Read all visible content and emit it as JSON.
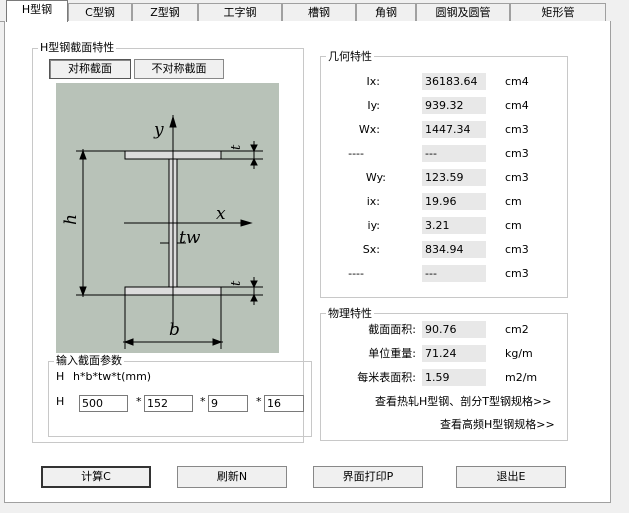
{
  "tabs": [
    "H型钢",
    "C型钢",
    "Z型钢",
    "工字钢",
    "槽钢",
    "角钢",
    "圆钢及圆管",
    "矩形管"
  ],
  "section": {
    "title": "H型钢截面特性",
    "sym_button": "对称截面",
    "asym_button": "不对称截面"
  },
  "diagram": {
    "y_label": "y",
    "x_label": "x",
    "tw_label": "tw",
    "h_label": "h",
    "b_label": "b",
    "t_top_label": "t",
    "t_bottom_label": "t"
  },
  "input": {
    "title": "输入截面参数",
    "prefix": "H",
    "formula": "h*b*tw*t(mm)",
    "row_label": "H",
    "h_value": "500",
    "b_value": "152",
    "tw_value": "9",
    "t_value": "16",
    "sep1": "*",
    "sep2": "*",
    "sep3": "*"
  },
  "geometry": {
    "title": "几何特性",
    "rows": [
      {
        "label": "Ix:",
        "value": "36183.64",
        "unit": "cm4"
      },
      {
        "label": "Iy:",
        "value": "939.32",
        "unit": "cm4"
      },
      {
        "label": "Wx:",
        "value": "1447.34",
        "unit": "cm3"
      },
      {
        "label": "----",
        "value": "---",
        "unit": "cm3"
      },
      {
        "label": "Wy:",
        "value": "123.59",
        "unit": "cm3"
      },
      {
        "label": "ix:",
        "value": "19.96",
        "unit": "cm"
      },
      {
        "label": "iy:",
        "value": "3.21",
        "unit": "cm"
      },
      {
        "label": "Sx:",
        "value": "834.94",
        "unit": "cm3"
      },
      {
        "label": "----",
        "value": "---",
        "unit": "cm3"
      }
    ]
  },
  "physical": {
    "title": "物理特性",
    "rows": [
      {
        "label": "截面面积:",
        "value": "90.76",
        "unit": "cm2"
      },
      {
        "label": "单位重量:",
        "value": "71.24",
        "unit": "kg/m"
      },
      {
        "label": "每米表面积:",
        "value": "1.59",
        "unit": "m2/m"
      }
    ],
    "link1": "查看热轧H型钢、剖分T型钢规格>>",
    "link2": "查看高频H型钢规格>>"
  },
  "buttons": {
    "calc": "计算C",
    "refresh": "刷新N",
    "print": "界面打印P",
    "exit": "退出E"
  }
}
